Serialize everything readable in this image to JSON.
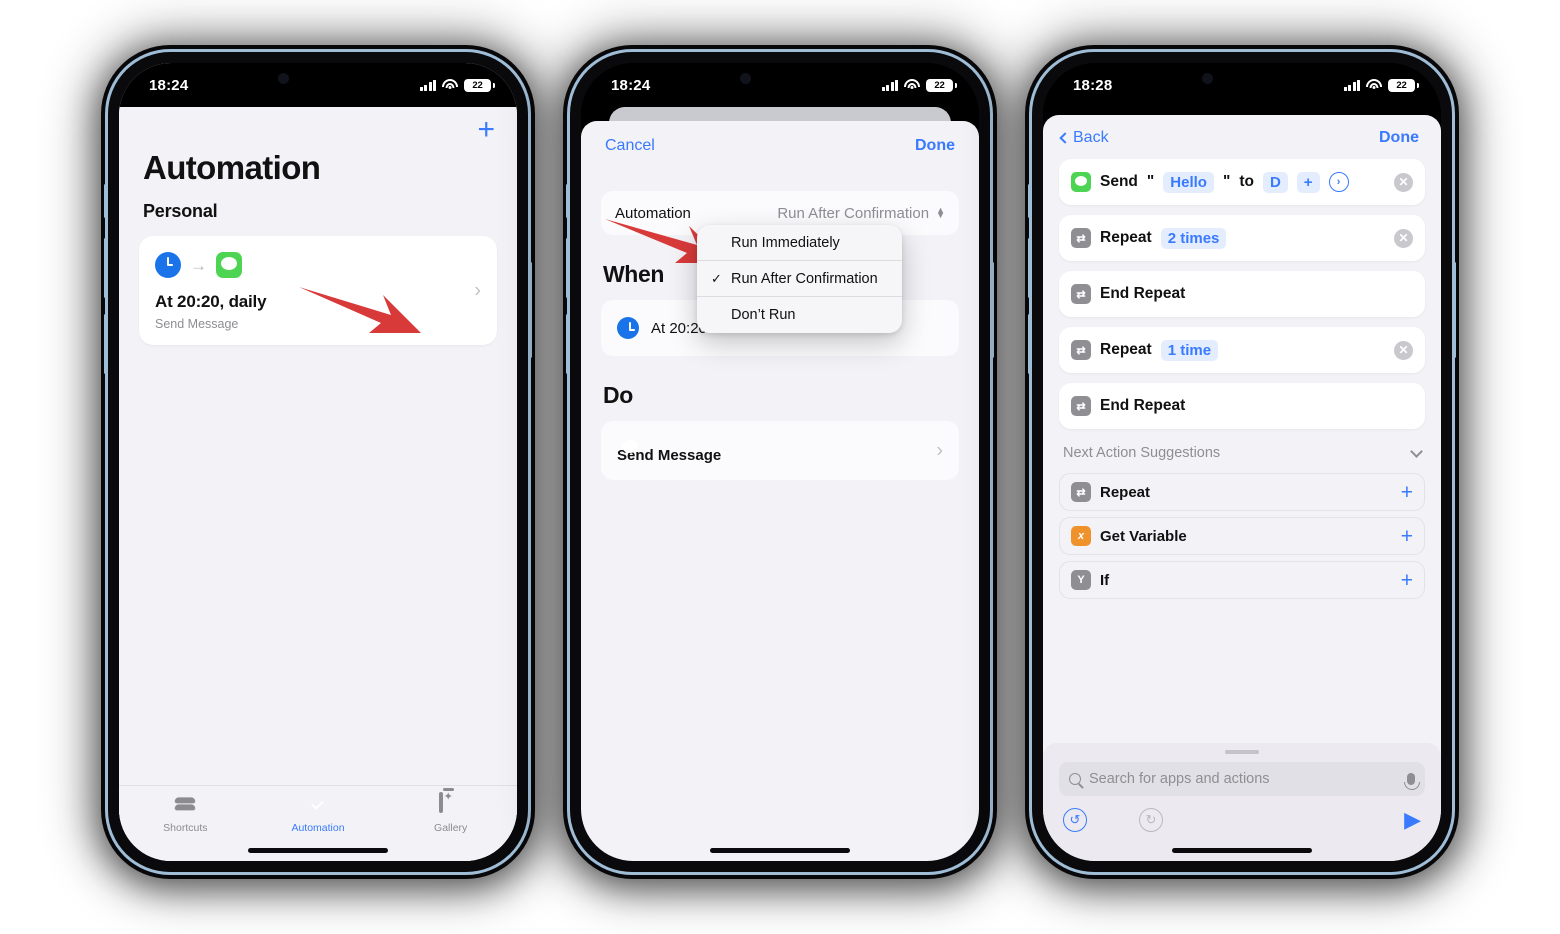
{
  "phone1": {
    "status": {
      "time": "18:24",
      "battery": "22",
      "signal_icon": "cellular-bars-icon",
      "wifi_icon": "wifi-icon"
    },
    "add_button": "+",
    "title": "Automation",
    "section": "Personal",
    "card": {
      "trigger_icon": "clock-icon",
      "arrow_icon": "arrow-right-icon",
      "app_icon": "messages-icon",
      "title": "At 20:20, daily",
      "subtitle": "Send Message",
      "chevron": "›"
    },
    "tabs": [
      {
        "label": "Shortcuts",
        "icon": "layers-icon",
        "active": false
      },
      {
        "label": "Automation",
        "icon": "check-circle-icon",
        "active": true
      },
      {
        "label": "Gallery",
        "icon": "gallery-icon",
        "active": false
      }
    ]
  },
  "phone2": {
    "status": {
      "time": "18:24",
      "battery": "22"
    },
    "nav": {
      "cancel": "Cancel",
      "done": "Done"
    },
    "automation_row": {
      "label": "Automation",
      "value": "Run After Confirmation"
    },
    "menu": [
      {
        "label": "Run Immediately",
        "checked": false
      },
      {
        "label": "Run After Confirmation",
        "checked": true
      },
      {
        "label": "Don’t Run",
        "checked": false
      }
    ],
    "when": {
      "heading": "When",
      "item": "At 20:20",
      "icon": "clock-icon"
    },
    "do": {
      "heading": "Do",
      "item": "Send Message",
      "icon": "messages-icon",
      "chevron": "›"
    }
  },
  "phone3": {
    "status": {
      "time": "18:28",
      "battery": "22"
    },
    "nav": {
      "back": "Back",
      "done": "Done"
    },
    "actions": [
      {
        "icon": "messages-icon",
        "parts": [
          {
            "t": "text",
            "v": "Send"
          },
          {
            "t": "quote",
            "v": "\""
          },
          {
            "t": "chip",
            "v": "Hello"
          },
          {
            "t": "quote",
            "v": "\""
          },
          {
            "t": "text",
            "v": "to"
          },
          {
            "t": "chip",
            "v": "D"
          },
          {
            "t": "chip",
            "v": "+"
          },
          {
            "t": "circle",
            "v": "›"
          }
        ],
        "deletable": true
      },
      {
        "icon": "repeat-icon",
        "label": "Repeat",
        "chip": "2 times",
        "deletable": true
      },
      {
        "icon": "repeat-icon",
        "label": "End Repeat",
        "chip": "",
        "deletable": false
      },
      {
        "icon": "repeat-icon",
        "label": "Repeat",
        "chip": "1 time",
        "deletable": true
      },
      {
        "icon": "repeat-icon",
        "label": "End Repeat",
        "chip": "",
        "deletable": false
      }
    ],
    "suggestions_header": "Next Action Suggestions",
    "suggestions": [
      {
        "label": "Repeat",
        "icon": "repeat-icon",
        "icon_glyph": "⇄",
        "color": "#8e8e93",
        "add": "+"
      },
      {
        "label": "Get Variable",
        "icon": "variable-icon",
        "icon_glyph": "x",
        "color": "#f0922b",
        "add": "+"
      },
      {
        "label": "If",
        "icon": "if-icon",
        "icon_glyph": "Y",
        "color": "#8e8e93",
        "add": "+"
      }
    ],
    "search_placeholder": "Search for apps and actions",
    "toolbar": {
      "undo": "↺",
      "redo": "↻",
      "run": "▶"
    }
  },
  "colors": {
    "accent": "#3a7afe",
    "arrow": "#d83a3a",
    "green": "#4cd452",
    "orange": "#f0922b"
  }
}
